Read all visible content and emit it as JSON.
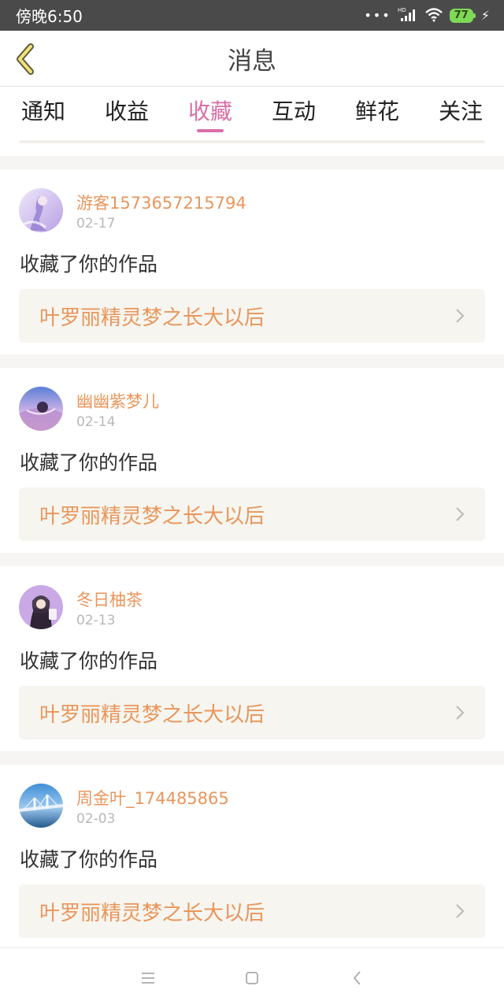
{
  "status_bar": {
    "time": "傍晚6:50",
    "battery": "77",
    "icons": [
      "dots-icon",
      "hd-signal-icon",
      "wifi-icon",
      "battery-icon",
      "charging-icon"
    ]
  },
  "header": {
    "title": "消息",
    "back_icon": "chevron-left-icon"
  },
  "tabs": [
    {
      "label": "通知",
      "active": false
    },
    {
      "label": "收益",
      "active": false
    },
    {
      "label": "收藏",
      "active": true
    },
    {
      "label": "互动",
      "active": false
    },
    {
      "label": "鲜花",
      "active": false
    },
    {
      "label": "关注",
      "active": false
    }
  ],
  "messages": [
    {
      "username": "游客1573657215794",
      "date": "02-17",
      "action": "收藏了你的作品",
      "work_title": "叶罗丽精灵梦之长大以后"
    },
    {
      "username": "幽幽紫梦儿",
      "date": "02-14",
      "action": "收藏了你的作品",
      "work_title": "叶罗丽精灵梦之长大以后"
    },
    {
      "username": "冬日柚茶",
      "date": "02-13",
      "action": "收藏了你的作品",
      "work_title": "叶罗丽精灵梦之长大以后"
    },
    {
      "username": "周金叶_174485865",
      "date": "02-03",
      "action": "收藏了你的作品",
      "work_title": "叶罗丽精灵梦之长大以后"
    }
  ],
  "colors": {
    "accent_pink": "#d96ea5",
    "username_orange": "#e8965c",
    "link_bg": "#f6f5ef",
    "back_arrow": "#f0e27a"
  },
  "bottom_nav": [
    "menu-icon",
    "home-icon",
    "back-icon"
  ]
}
